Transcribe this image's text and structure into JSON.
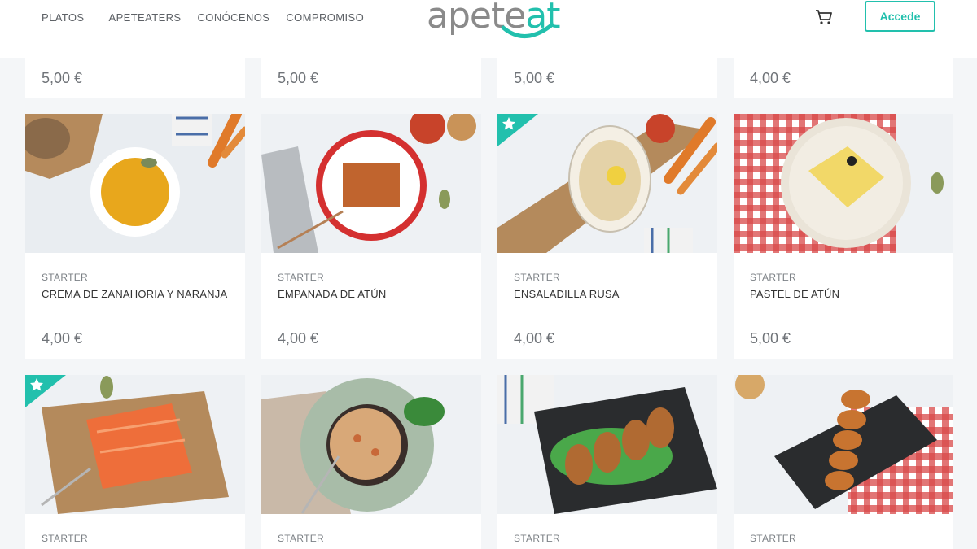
{
  "nav": {
    "items": [
      {
        "label": "PLATOS"
      },
      {
        "label": "APETEATERS"
      },
      {
        "label": "CONÓCENOS"
      },
      {
        "label": "COMPROMISO"
      }
    ],
    "logo_text_gray": "apete",
    "logo_text_accent": "at",
    "cart_icon": "cart-icon",
    "login_label": "Accede"
  },
  "colors": {
    "accent": "#22c0ad",
    "logo_gray": "#8a8a8a",
    "page_bg": "#f4f6f8"
  },
  "top_row": [
    {
      "price": "5,00 €"
    },
    {
      "price": "5,00 €"
    },
    {
      "price": "5,00 €"
    },
    {
      "price": "4,00 €"
    }
  ],
  "middle_row": [
    {
      "category": "STARTER",
      "name": "CREMA DE ZANAHORIA Y NARANJA",
      "price": "4,00 €",
      "featured": false
    },
    {
      "category": "STARTER",
      "name": "EMPANADA DE ATÚN",
      "price": "4,00 €",
      "featured": false
    },
    {
      "category": "STARTER",
      "name": "ENSALADILLA RUSA",
      "price": "4,00 €",
      "featured": true
    },
    {
      "category": "STARTER",
      "name": "PASTEL DE ATÚN",
      "price": "5,00 €",
      "featured": false
    }
  ],
  "bottom_row": [
    {
      "category": "STARTER",
      "featured": true
    },
    {
      "category": "STARTER",
      "featured": false
    },
    {
      "category": "STARTER",
      "featured": false
    },
    {
      "category": "STARTER",
      "featured": false
    }
  ]
}
